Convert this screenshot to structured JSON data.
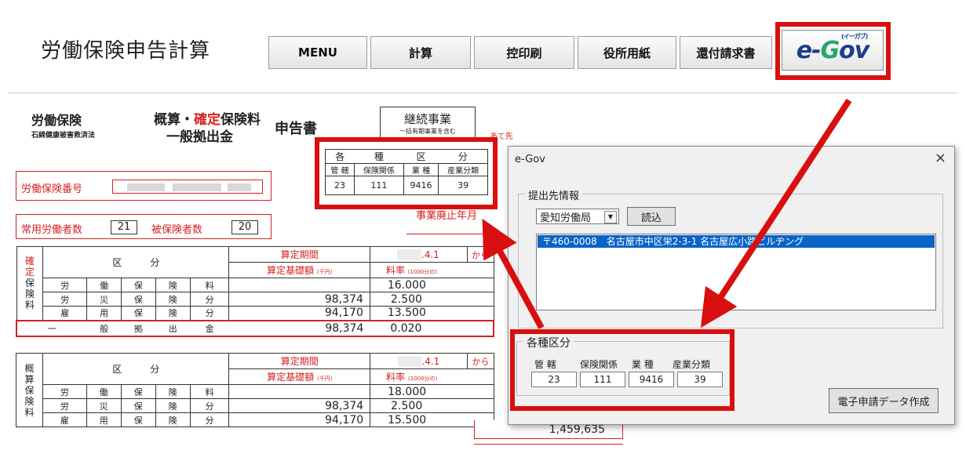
{
  "app": {
    "title": "労働保険申告計算"
  },
  "toolbar": {
    "menu": "MENU",
    "calc": "計算",
    "copy_print": "控印刷",
    "office_paper": "役所用紙",
    "refund": "還付請求書",
    "egov_logo_prefix": "e-",
    "egov_logo_g": "G",
    "egov_logo_rest": "ov",
    "egov_sub": "(イーガブ)"
  },
  "form": {
    "title_left": "労働保険",
    "title_left_sub": "石綿健康被害救済法",
    "title_mid_a": "概算・",
    "title_mid_red": "確定",
    "title_mid_b": "保険料",
    "title_mid_line2": "一般拠出金",
    "title_right": "申告書",
    "continuing": "継続事業",
    "continuing_sub": "一括有期事業を含む",
    "addressee": "あて先",
    "insurance_no_label": "労働保険番号",
    "regular_workers_label": "常用労働者数",
    "regular_workers": "21",
    "insured_label": "被保険者数",
    "insured": "20",
    "abolition_label": "事業廃止年月",
    "kubun": {
      "header": [
        "各",
        "種",
        "区",
        "分"
      ],
      "cols": [
        "管 轄",
        "保険関係",
        "業 種",
        "産業分類"
      ],
      "values": [
        "23",
        "111",
        "9416",
        "39"
      ]
    }
  },
  "confirmed": {
    "side": "確定保険料",
    "header_label": "区　　　分",
    "period_label": "算定期間",
    "period_date": ".4.1",
    "period_from": "から",
    "base_label": "算定基礎額",
    "base_unit": "(千円)",
    "rate_label": "料率",
    "rate_unit": "(1000分の)",
    "rows": [
      {
        "label": [
          "労",
          "働",
          "保",
          "険",
          "料"
        ],
        "base": "",
        "rate": "16.000"
      },
      {
        "label": [
          "労",
          "災",
          "保",
          "険",
          "分"
        ],
        "base": "98,374",
        "rate": "2.500"
      },
      {
        "label": [
          "雇",
          "用",
          "保",
          "険",
          "分"
        ],
        "base": "94,170",
        "rate": "13.500"
      }
    ],
    "general": {
      "label": [
        "一",
        "般",
        "拠",
        "出",
        "金"
      ],
      "base": "98,374",
      "rate": "0.020"
    }
  },
  "estimated": {
    "side": "概算保険料",
    "header_label": "区　　　分",
    "period_label": "算定期間",
    "period_date": ".4.1",
    "period_from": "から",
    "base_label": "算定基礎額",
    "base_unit": "(千円)",
    "rate_label": "料率",
    "rate_unit": "(1000分の)",
    "rows": [
      {
        "label": [
          "労",
          "働",
          "保",
          "険",
          "料"
        ],
        "base": "",
        "rate": "18.000"
      },
      {
        "label": [
          "労",
          "災",
          "保",
          "険",
          "分"
        ],
        "base": "98,374",
        "rate": "2.500"
      },
      {
        "label": [
          "雇",
          "用",
          "保",
          "険",
          "分"
        ],
        "base": "94,170",
        "rate": "15.500",
        "amount": "1,459,635"
      }
    ]
  },
  "dialog": {
    "title": "e-Gov",
    "close": "×",
    "submit_group": "提出先情報",
    "office_select": "愛知労働局",
    "load_button": "読込",
    "list_item": "〒460-0008　名古屋市中区栄2-3-1 名古屋広小路ビルヂング",
    "kubun_group": "各種区分",
    "cols": [
      "管 轄",
      "保険関係",
      "業 種",
      "産業分類"
    ],
    "values": [
      "23",
      "111",
      "9416",
      "39"
    ],
    "create_button": "電子申請データ作成"
  },
  "colors": {
    "highlight": "#d90f0f",
    "form_red": "#d62020",
    "selection": "#0a64c8"
  }
}
